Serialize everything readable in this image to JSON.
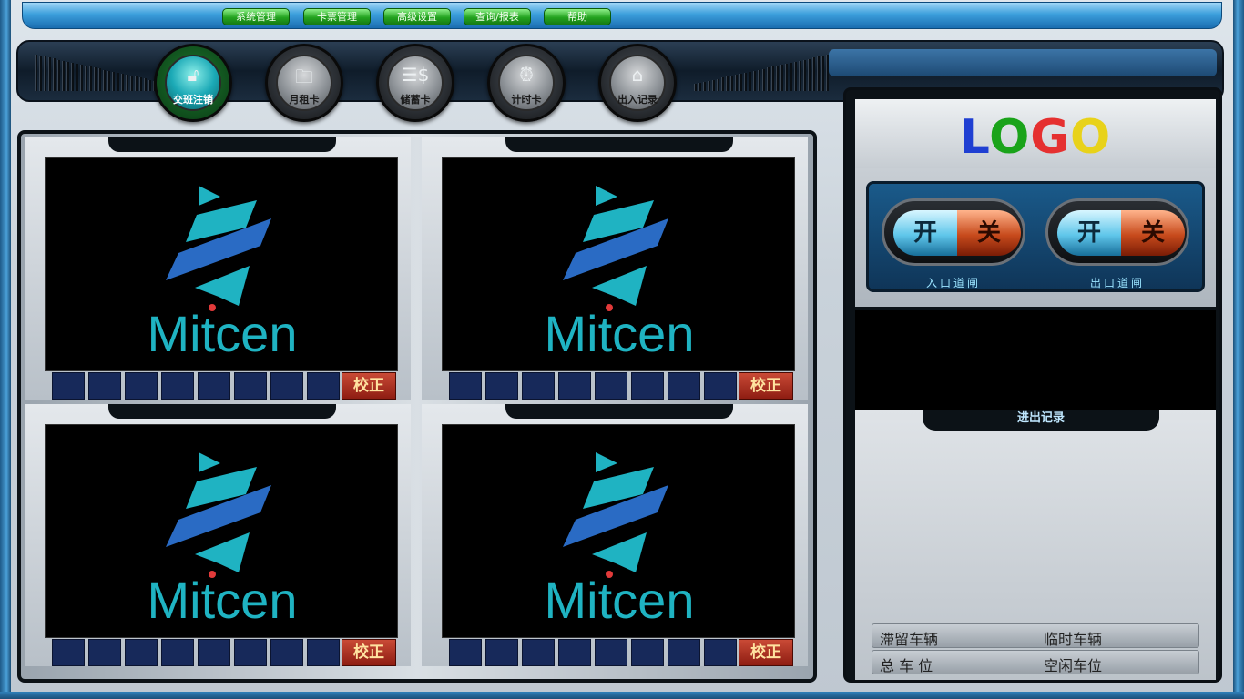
{
  "menu": {
    "items": [
      "系统管理",
      "卡票管理",
      "高级设置",
      "查询/报表",
      "帮助"
    ]
  },
  "nav": {
    "buttons": [
      {
        "label": "交班注销",
        "icon": "lock-icon"
      },
      {
        "label": "月租卡",
        "icon": "folder-icon"
      },
      {
        "label": "储蓄卡",
        "icon": "money-card-icon"
      },
      {
        "label": "计时卡",
        "icon": "alarm-clock-icon"
      },
      {
        "label": "出入记录",
        "icon": "house-icon"
      }
    ]
  },
  "cameras": {
    "brand": "Mitcen",
    "calibrate_label": "校正",
    "count": 4
  },
  "right": {
    "logo": {
      "letters": [
        "L",
        "O",
        "G",
        "O"
      ],
      "colors": [
        "#1f3fd2",
        "#1aa31a",
        "#e53030",
        "#e8d21a"
      ]
    },
    "entry_gate": {
      "on": "开",
      "off": "关",
      "label": "入口道闸"
    },
    "exit_gate": {
      "on": "开",
      "off": "关",
      "label": "出口道闸"
    },
    "records_title": "进出记录",
    "stats": {
      "stranded": "滞留车辆",
      "temporary": "临时车辆",
      "total": "总 车 位",
      "free": "空闲车位"
    }
  },
  "colors": {
    "brand_cyan": "#1fb3c2",
    "brand_blue": "#2a6bc4",
    "brand_red": "#e23a3a",
    "slot_navy": "#17295a"
  }
}
